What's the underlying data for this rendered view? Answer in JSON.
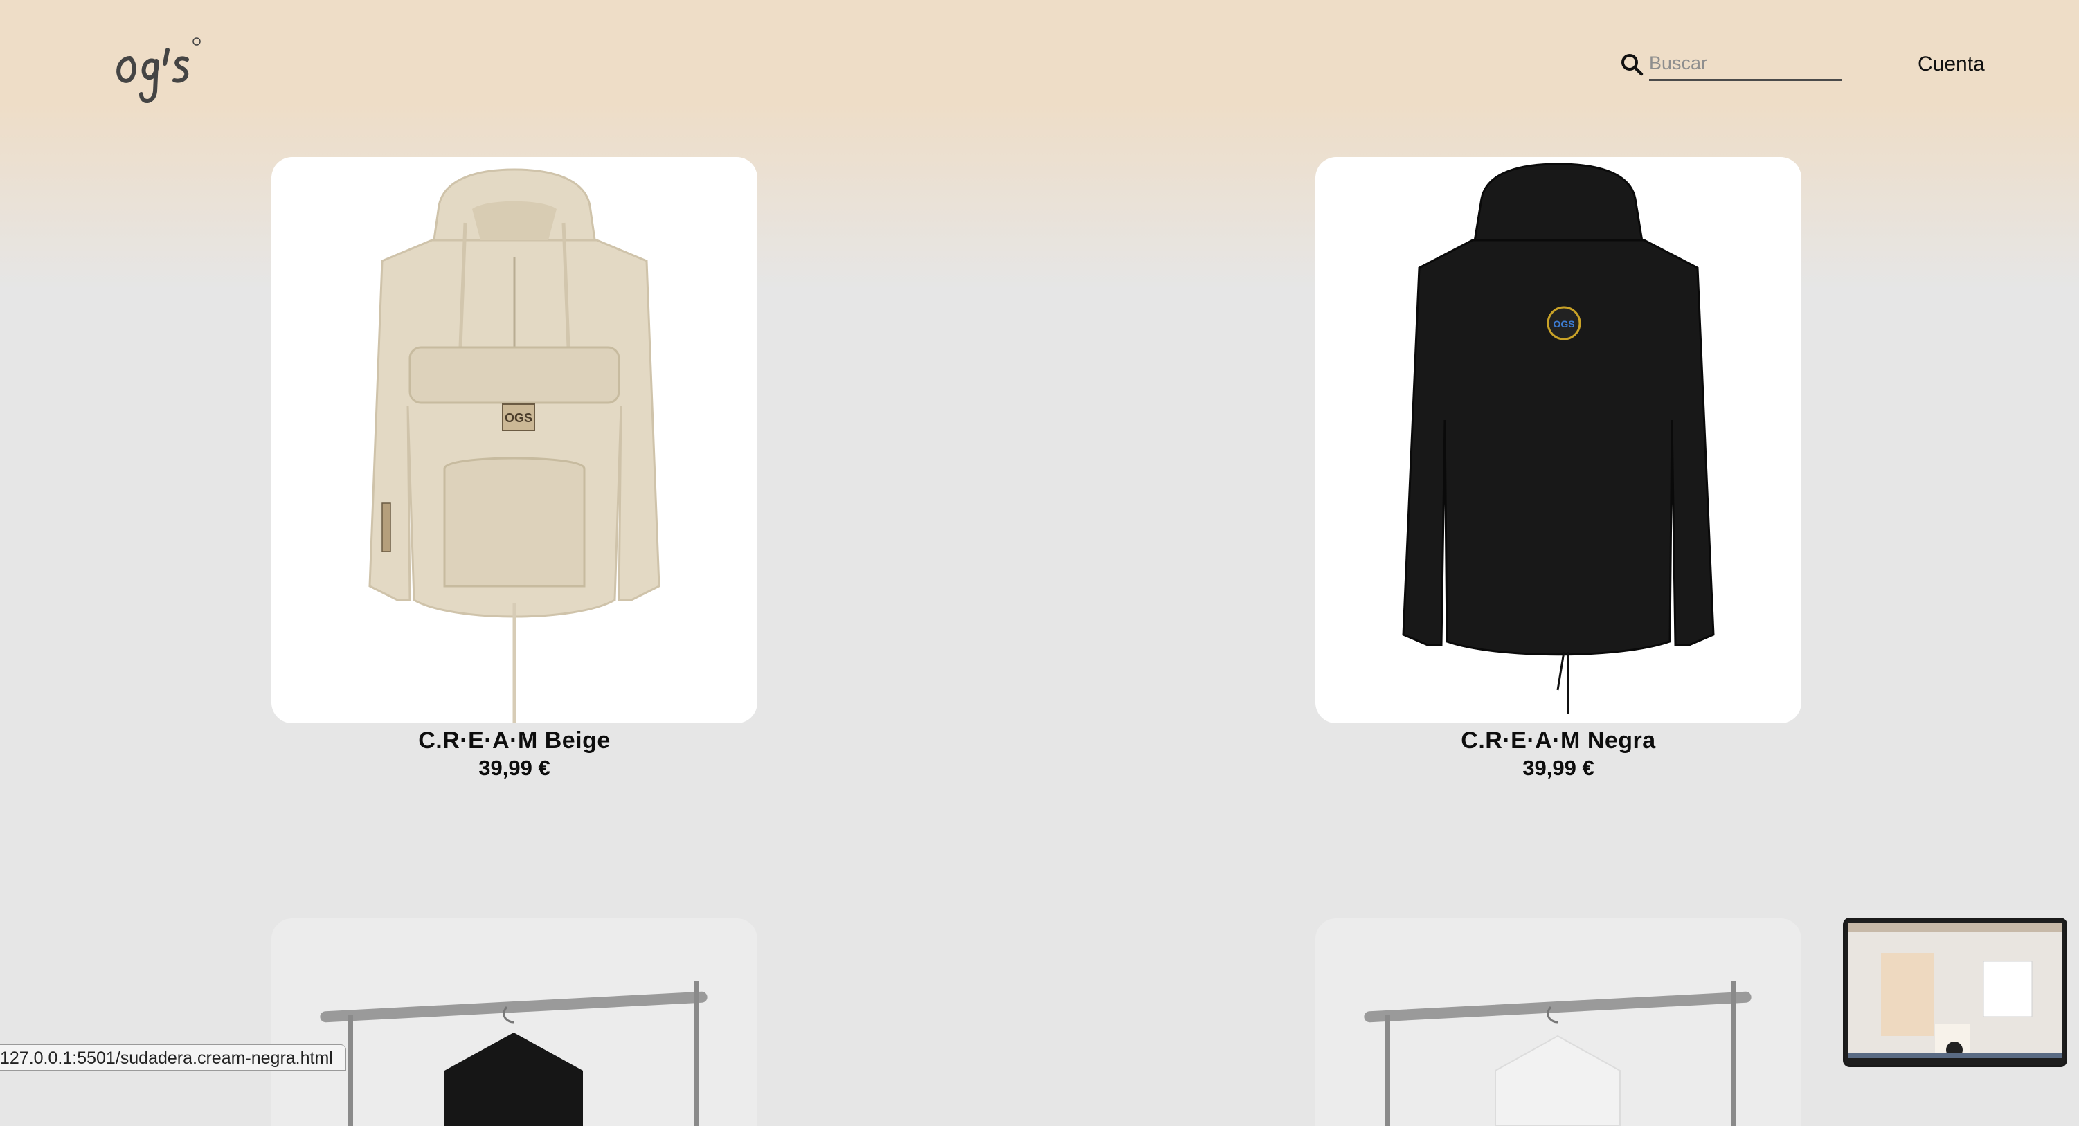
{
  "header": {
    "logo_text": "ogs",
    "search": {
      "placeholder": "Buscar",
      "value": ""
    },
    "account_label": "Cuenta"
  },
  "products": [
    {
      "name": "C.R·E·A·M Beige",
      "price": "39,99 €",
      "color": "#e6dcc8"
    },
    {
      "name": "C.R·E·A·M Negra",
      "price": "39,99 €",
      "color": "#161616"
    }
  ],
  "status_bar": {
    "url": "127.0.0.1:5501/sudadera.cream-negra.html"
  },
  "colors": {
    "header_bg": "#eeddc7",
    "page_bg": "#e6e6e6",
    "text": "#0d0d0d"
  }
}
